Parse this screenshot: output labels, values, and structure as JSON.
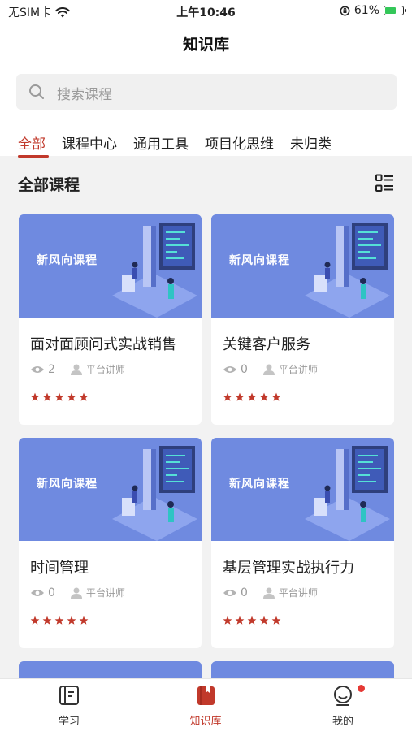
{
  "status_bar": {
    "carrier": "无SIM卡",
    "time": "上午10:46",
    "battery": "61%",
    "battery_level": 0.61
  },
  "header": {
    "title": "知识库"
  },
  "search": {
    "placeholder": "搜索课程"
  },
  "tabs": [
    {
      "label": "全部",
      "active": true
    },
    {
      "label": "课程中心",
      "active": false
    },
    {
      "label": "通用工具",
      "active": false
    },
    {
      "label": "项目化思维",
      "active": false
    },
    {
      "label": "未归类",
      "active": false
    }
  ],
  "section": {
    "title": "全部课程"
  },
  "courses": [
    {
      "banner_text": "新风向课程",
      "title": "面对面顾问式实战销售",
      "views": "2",
      "lecturer": "平台讲师",
      "stars": 5
    },
    {
      "banner_text": "新风向课程",
      "title": "关键客户服务",
      "views": "0",
      "lecturer": "平台讲师",
      "stars": 5
    },
    {
      "banner_text": "新风向课程",
      "title": "时间管理",
      "views": "0",
      "lecturer": "平台讲师",
      "stars": 5
    },
    {
      "banner_text": "新风向课程",
      "title": "基层管理实战执行力",
      "views": "0",
      "lecturer": "平台讲师",
      "stars": 5
    }
  ],
  "tabbar": [
    {
      "label": "学习",
      "icon": "book-icon",
      "active": false
    },
    {
      "label": "知识库",
      "icon": "knowledge-icon",
      "active": true
    },
    {
      "label": "我的",
      "icon": "profile-icon",
      "active": false,
      "badge": true
    }
  ],
  "colors": {
    "accent": "#c1392b",
    "banner": "#6f8ae0",
    "background": "#f2f2f2"
  }
}
